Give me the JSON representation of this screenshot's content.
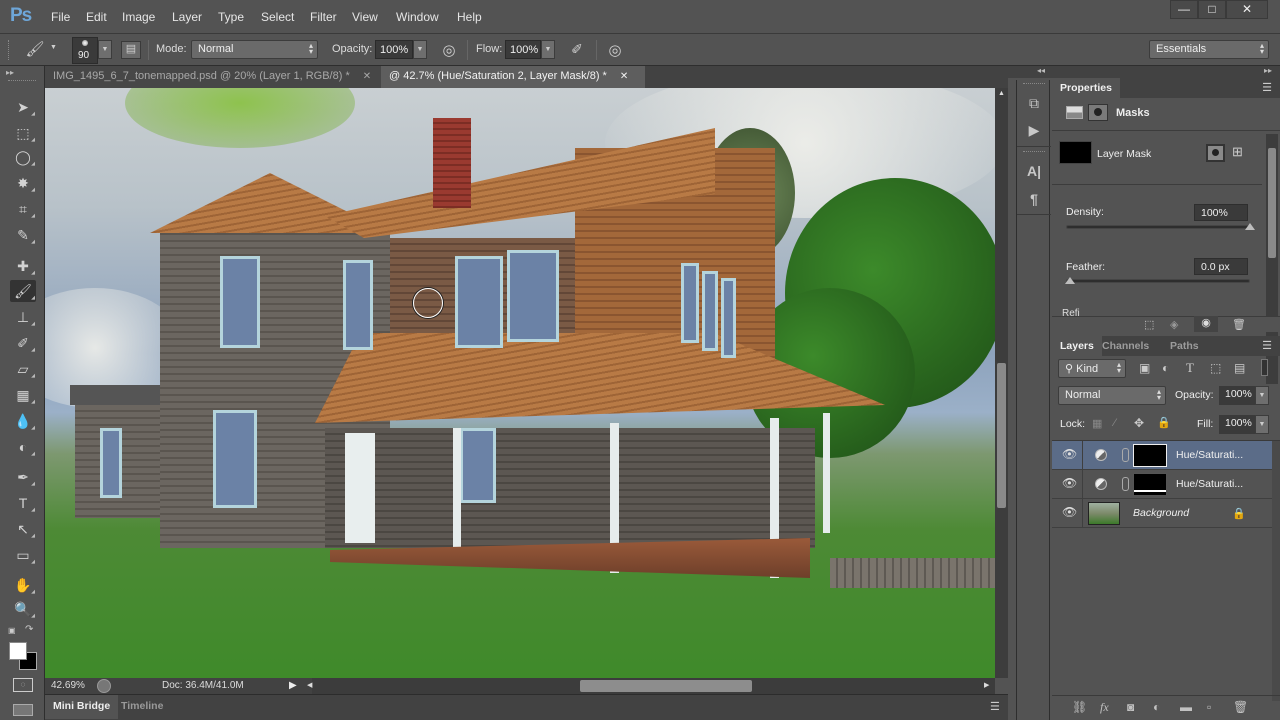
{
  "app": {
    "logo": "Ps",
    "menu": [
      "File",
      "Edit",
      "Image",
      "Layer",
      "Type",
      "Select",
      "Filter",
      "View",
      "Window",
      "Help"
    ],
    "window_controls": {
      "minimize": "—",
      "maximize": "□",
      "close": "✕"
    }
  },
  "options_bar": {
    "tool_icon": "brush-icon",
    "brush_size": "90",
    "mode_label": "Mode:",
    "mode_value": "Normal",
    "opacity_label": "Opacity:",
    "opacity_value": "100%",
    "flow_label": "Flow:",
    "flow_value": "100%",
    "workspace": "Essentials"
  },
  "doc_tabs": [
    {
      "label": "IMG_1495_6_7_tonemapped.psd @ 20% (Layer 1, RGB/8) *",
      "active": false,
      "close": "✕"
    },
    {
      "label": "@ 42.7% (Hue/Saturation 2, Layer Mask/8) *",
      "active": true,
      "close": "✕"
    }
  ],
  "tools": [
    {
      "name": "move-tool",
      "glyph": "➤"
    },
    {
      "name": "marquee-tool",
      "glyph": "⬚"
    },
    {
      "name": "lasso-tool",
      "glyph": "◯"
    },
    {
      "name": "magic-wand-tool",
      "glyph": "✸"
    },
    {
      "name": "crop-tool",
      "glyph": "⌗"
    },
    {
      "name": "eyedropper-tool",
      "glyph": "✎"
    },
    {
      "name": "spot-healing-tool",
      "glyph": "✚"
    },
    {
      "name": "brush-tool",
      "glyph": "🖌",
      "selected": true
    },
    {
      "name": "clone-stamp-tool",
      "glyph": "⊥"
    },
    {
      "name": "history-brush-tool",
      "glyph": "✐"
    },
    {
      "name": "eraser-tool",
      "glyph": "▱"
    },
    {
      "name": "gradient-tool",
      "glyph": "▦"
    },
    {
      "name": "blur-tool",
      "glyph": "💧"
    },
    {
      "name": "dodge-tool",
      "glyph": "◐"
    },
    {
      "name": "pen-tool",
      "glyph": "✒"
    },
    {
      "name": "type-tool",
      "glyph": "T"
    },
    {
      "name": "path-selection-tool",
      "glyph": "↖"
    },
    {
      "name": "rectangle-tool",
      "glyph": "▭"
    },
    {
      "name": "hand-tool",
      "glyph": "✋"
    },
    {
      "name": "zoom-tool",
      "glyph": "🔍"
    }
  ],
  "colors": {
    "foreground": "#ffffff",
    "background": "#000000",
    "accent_selected_layer": "#5b6c88",
    "logo": "#6ea6d8"
  },
  "status": {
    "zoom": "42.69%",
    "doc_size": "Doc: 36.4M/41.0M"
  },
  "bottom_tabs": [
    "Mini Bridge",
    "Timeline"
  ],
  "properties": {
    "tab": "Properties",
    "section": "Masks",
    "mask_type": "Layer Mask",
    "density_label": "Density:",
    "density_value": "100%",
    "density_fraction": 1.0,
    "feather_label": "Feather:",
    "feather_value": "0.0 px",
    "feather_fraction": 0.0,
    "refine_partial": "Refi"
  },
  "layers_panel": {
    "tabs": [
      "Layers",
      "Channels",
      "Paths"
    ],
    "filter_kind": "Kind",
    "blend_mode": "Normal",
    "opacity_label": "Opacity:",
    "opacity_value": "100%",
    "lock_label": "Lock:",
    "fill_label": "Fill:",
    "fill_value": "100%",
    "layers": [
      {
        "name": "Hue/Saturati...",
        "type": "adjustment",
        "selected": true,
        "visible": true
      },
      {
        "name": "Hue/Saturati...",
        "type": "adjustment",
        "selected": false,
        "visible": true
      },
      {
        "name": "Background",
        "type": "image",
        "selected": false,
        "visible": true,
        "locked": true
      }
    ]
  }
}
